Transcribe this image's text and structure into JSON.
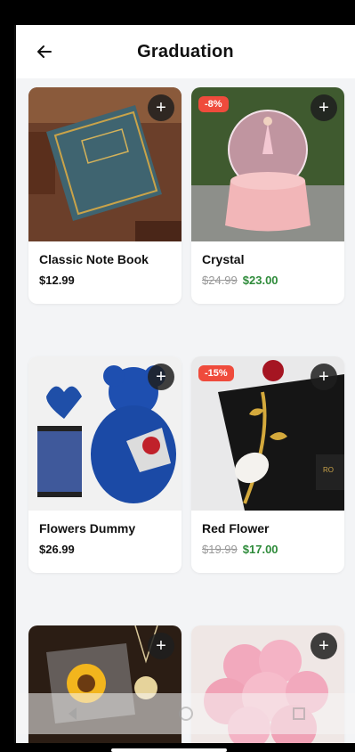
{
  "header": {
    "title": "Graduation"
  },
  "icons": {
    "back": "arrow-left-icon",
    "add": "plus-icon",
    "nav_back": "triangle-back-icon",
    "nav_home": "circle-home-icon",
    "nav_recent": "square-recent-icon"
  },
  "colors": {
    "badge": "#ef4b3c",
    "sale_price": "#2e8b3a",
    "background": "#f3f4f6"
  },
  "products": [
    {
      "name": "Classic Note Book",
      "price": "$12.99",
      "old_price": "",
      "new_price": "",
      "discount": ""
    },
    {
      "name": "Crystal",
      "price": "",
      "old_price": "$24.99",
      "new_price": "$23.00",
      "discount": "-8%"
    },
    {
      "name": "Flowers Dummy",
      "price": "$26.99",
      "old_price": "",
      "new_price": "",
      "discount": ""
    },
    {
      "name": "Red Flower",
      "price": "",
      "old_price": "$19.99",
      "new_price": "$17.00",
      "discount": "-15%"
    },
    {
      "name": "",
      "price": "",
      "old_price": "",
      "new_price": "",
      "discount": ""
    },
    {
      "name": "",
      "price": "",
      "old_price": "",
      "new_price": "",
      "discount": ""
    }
  ]
}
